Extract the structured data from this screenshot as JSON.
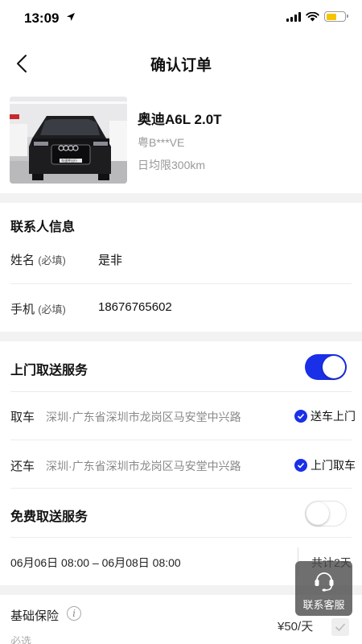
{
  "status_bar": {
    "time": "13:09"
  },
  "nav": {
    "title": "确认订单"
  },
  "car": {
    "name": "奥迪A6L 2.0T",
    "plate": "粤B***VE",
    "mileage_limit": "日均限300km",
    "photo_plate_text": "车速呼出行"
  },
  "contact": {
    "section_title": "联系人信息",
    "name_label": "姓名",
    "name_hint": "(必填)",
    "name_value": "是非",
    "phone_label": "手机",
    "phone_hint": "(必填)",
    "phone_value": "18676765602"
  },
  "delivery": {
    "section_title": "上门取送服务",
    "enabled": true,
    "pickup_label": "取车",
    "pickup_address": "深圳·广东省深圳市龙岗区马安堂中兴路",
    "pickup_option": "送车上门",
    "return_label": "还车",
    "return_address": "深圳·广东省深圳市龙岗区马安堂中兴路",
    "return_option": "上门取车"
  },
  "free_service": {
    "title": "免费取送服务",
    "enabled": false
  },
  "rental_period": {
    "range": "06月06日 08:00 – 06月08日 08:00",
    "total": "共计2天"
  },
  "insurance": {
    "title": "基础保险",
    "required": "必选",
    "price": "¥50/天",
    "checked": true
  },
  "customer_service": {
    "label": "联系客服"
  },
  "colors": {
    "accent": "#1a2fe8",
    "battery": "#f5c400",
    "gap_bg": "#f2f2f2"
  }
}
